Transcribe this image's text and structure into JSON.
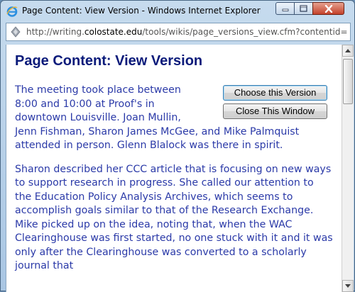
{
  "window": {
    "title": "Page Content: View Version - Windows Internet Explorer"
  },
  "address": {
    "url_prefix": "http://writing.",
    "url_domain": "colostate.edu",
    "url_suffix": "/tools/wikis/page_versions_view.cfm?contentid="
  },
  "page": {
    "title": "Page Content: View Version",
    "choose_button": "Choose this Version",
    "close_button": "Close This Window",
    "para1_lines": [
      "The meeting took place between",
      "8:00 and 10:00 at Proof's in",
      "downtown Louisville. Joan Mullin,"
    ],
    "para1_rest": "Jenn Fishman, Sharon James McGee, and Mike Palmquist attended in person. Glenn Blalock was there in spirit.",
    "para2": "Sharon described her CCC article that is focusing on new ways to support research in progress. She called our attention to the Education Policy Analysis Archives, which seems to accomplish goals similar to that of the Research Exchange. Mike picked up on the idea, noting that, when the WAC Clearinghouse was first started, no one stuck with it and it was only after the Clearinghouse was converted to a scholarly journal that"
  }
}
